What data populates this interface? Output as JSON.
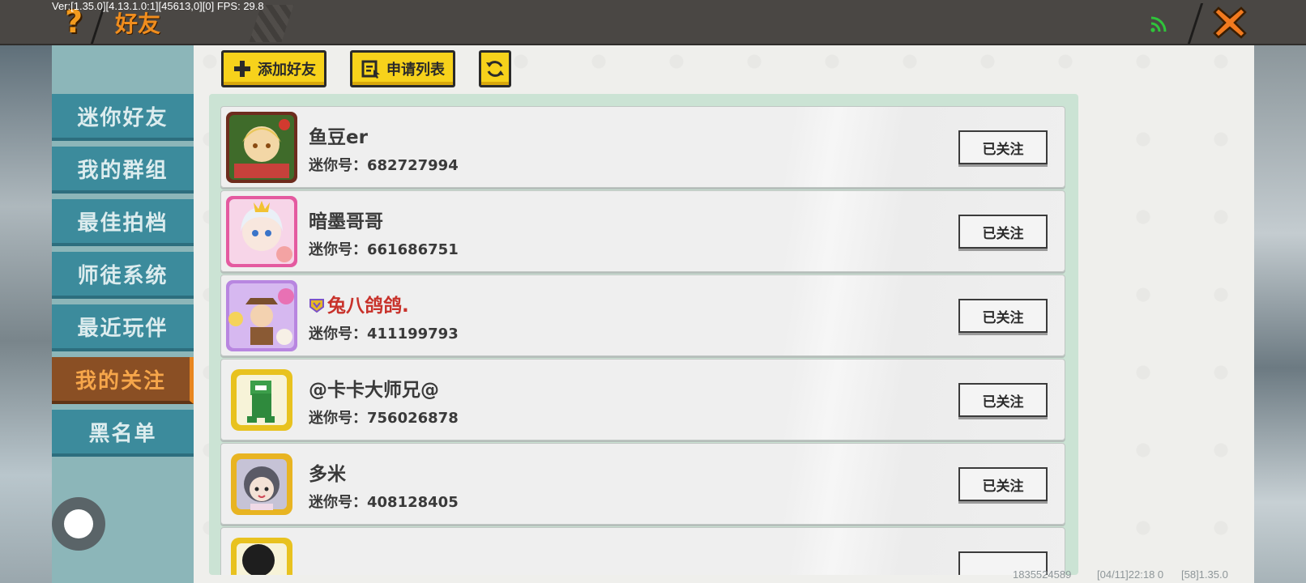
{
  "debug_text": "Ver:[1.35.0][4.13.1.0:1][45613,0][0] FPS: 29.8",
  "header": {
    "title": "好友",
    "help_icon": "question-mark-icon",
    "signal_icon": "wifi-signal-icon",
    "close_icon": "close-x-icon",
    "accent_color": "#f08d1e"
  },
  "sidebar": {
    "items": [
      {
        "label": "迷你好友",
        "active": false
      },
      {
        "label": "我的群组",
        "active": false
      },
      {
        "label": "最佳拍档",
        "active": false
      },
      {
        "label": "师徒系统",
        "active": false
      },
      {
        "label": "最近玩伴",
        "active": false
      },
      {
        "label": "我的关注",
        "active": true
      },
      {
        "label": "黑名单",
        "active": false
      }
    ]
  },
  "toolbar": {
    "add_friend_label": "添加好友",
    "request_list_label": "申请列表",
    "refresh_icon": "refresh-icon"
  },
  "following_list": {
    "id_prefix": "迷你号：",
    "follow_status_label": "已关注",
    "rows": [
      {
        "name": "鱼豆er",
        "mini_id": "682727994",
        "vip": false
      },
      {
        "name": "暗墨哥哥",
        "mini_id": "661686751",
        "vip": false
      },
      {
        "name": "兔八鸽鸽.",
        "mini_id": "411199793",
        "vip": true
      },
      {
        "name": "@卡卡大师兄@",
        "mini_id": "756026878",
        "vip": false
      },
      {
        "name": "多米",
        "mini_id": "408128405",
        "vip": false
      }
    ]
  },
  "footer": {
    "account": "1835524589",
    "time": "[04/11]22:18 0",
    "version": "[58]1.35.0"
  }
}
